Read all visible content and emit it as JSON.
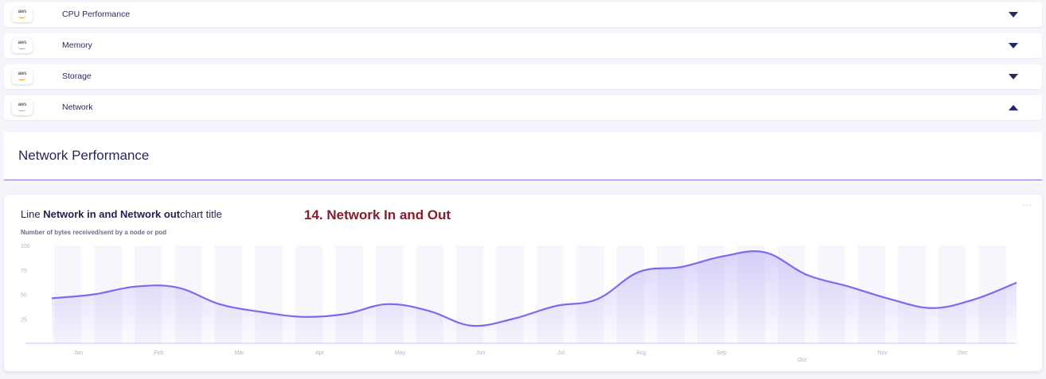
{
  "accordion": [
    {
      "label": "CPU Performance",
      "badge": "aws",
      "expanded": false
    },
    {
      "label": "Memory",
      "badge": "aws",
      "expanded": false
    },
    {
      "label": "Storage",
      "badge": "aws",
      "expanded": false
    },
    {
      "label": "Network",
      "badge": "aws",
      "expanded": true
    }
  ],
  "panel": {
    "title": "Network Performance"
  },
  "card": {
    "title_prefix": "Line ",
    "title_bold": "Network in and Network out",
    "title_suffix": "chart title",
    "subtitle": "Number of bytes received/sent by a node or pod",
    "overlay_label": "14. Network In and Out",
    "more": "···"
  },
  "colors": {
    "line": "#7b6af0",
    "fill": "#b9b0f6",
    "band": "#f6f6fc",
    "label_dark": "#8b1a2e"
  },
  "chart_data": {
    "type": "line",
    "categories": [
      "Jan",
      "Feb",
      "Mar",
      "Apr",
      "May",
      "Jun",
      "Jul",
      "Aug",
      "Sep",
      "Oct",
      "Nov",
      "Dec"
    ],
    "yticks": [
      100,
      75,
      50,
      25
    ],
    "ylim": [
      0,
      100
    ],
    "x": [
      0,
      1,
      2,
      3,
      4,
      5,
      6,
      7,
      8,
      9,
      10,
      11,
      12,
      13,
      14,
      15,
      16,
      17,
      18,
      19,
      20,
      21,
      22,
      23
    ],
    "values": [
      46,
      50,
      58,
      57,
      40,
      32,
      27,
      30,
      40,
      33,
      18,
      25,
      38,
      45,
      73,
      78,
      89,
      93,
      70,
      58,
      45,
      36,
      45,
      62
    ],
    "grid": false,
    "legend": "none"
  }
}
